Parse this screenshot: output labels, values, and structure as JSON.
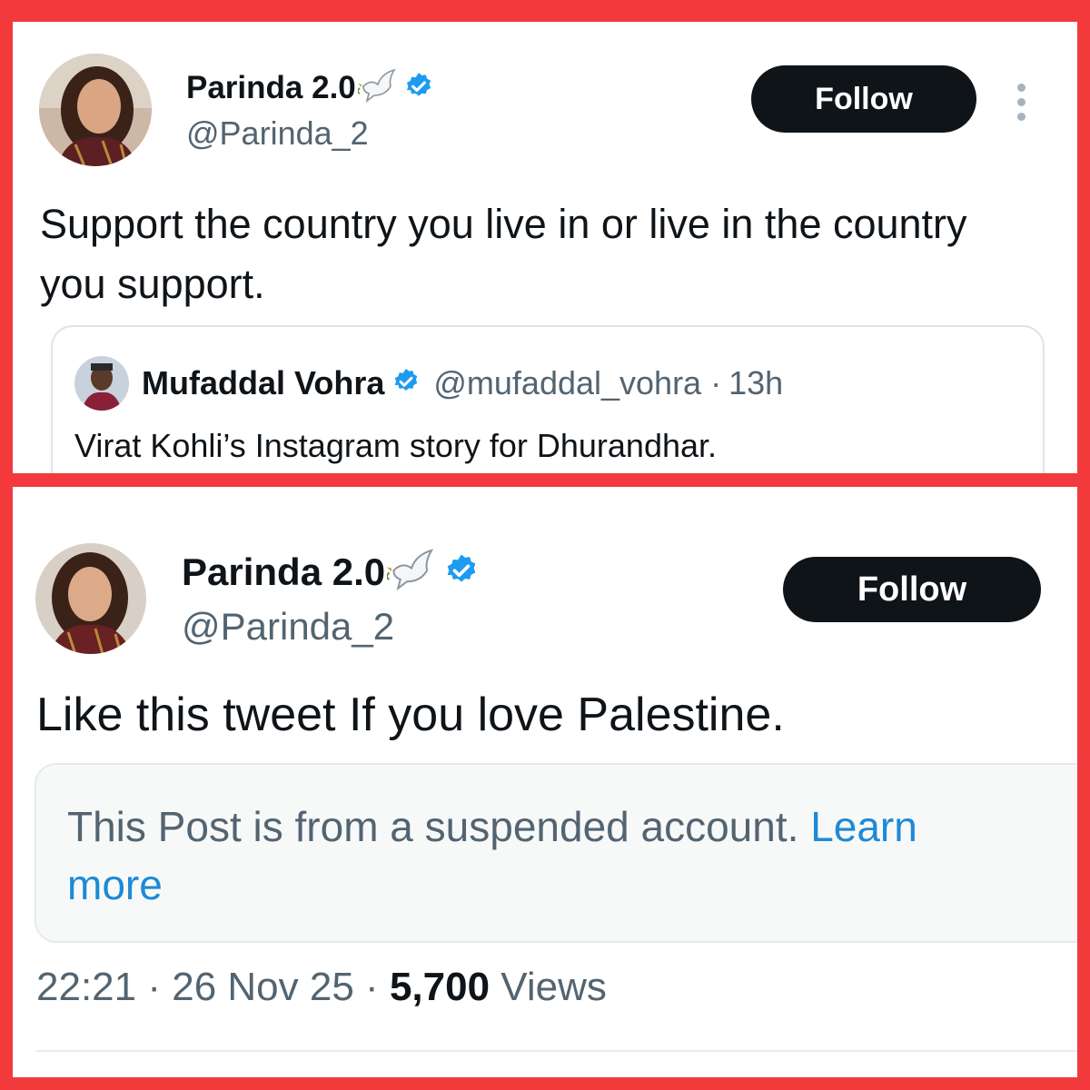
{
  "top_post": {
    "author": {
      "display_name": "Parinda 2.0",
      "handle": "@Parinda_2",
      "verified": true,
      "name_emoji": "dove-icon"
    },
    "follow_label": "Follow",
    "text": "Support the country you live in or live in the country you support.",
    "quoted_post": {
      "author_name": "Mufaddal Vohra",
      "verified": true,
      "handle": "@mufaddal_vohra",
      "separator": "·",
      "time": "13h",
      "text": "Virat Kohli’s Instagram story for Dhurandhar."
    }
  },
  "bottom_post": {
    "author": {
      "display_name": "Parinda 2.0",
      "handle": "@Parinda_2",
      "verified": true,
      "name_emoji": "dove-icon"
    },
    "follow_label": "Follow",
    "text": "Like this tweet If you love Palestine.",
    "suspended_notice": {
      "text": "This Post is from a suspended account.",
      "link": "Learn more"
    },
    "meta": {
      "time": "22:21",
      "sep1": "·",
      "date": "26 Nov 25",
      "sep2": "·",
      "views_count": "5,700",
      "views_label": "Views"
    }
  },
  "colors": {
    "frame": "#f23a3c",
    "verified_blue": "#1d9bf0",
    "link_blue": "#1d8ad6",
    "button_bg": "#0f1419"
  }
}
